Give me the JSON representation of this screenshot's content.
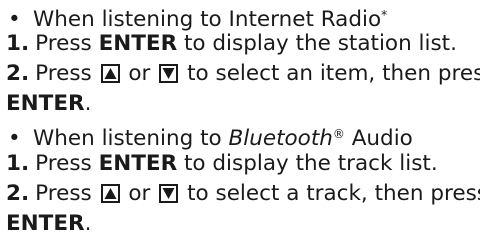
{
  "sections": [
    {
      "bullet": "•",
      "heading_prefix": "When listening to Internet Radio",
      "heading_mark": "*",
      "steps": [
        {
          "num": "1.",
          "pre": "Press ",
          "bold": "ENTER",
          "post": " to display the station list."
        },
        {
          "num": "2.",
          "pre": "Press ",
          "mid": " or ",
          "post": " to select an item, then press",
          "cont_bold": "ENTER",
          "cont_post": "."
        }
      ]
    },
    {
      "bullet": "•",
      "heading_prefix": "When listening to ",
      "heading_italic": "Bluetooth",
      "heading_reg": "®",
      "heading_suffix": " Audio",
      "steps": [
        {
          "num": "1.",
          "pre": "Press ",
          "bold": "ENTER",
          "post": " to display the track list."
        },
        {
          "num": "2.",
          "pre": "Press ",
          "mid": " or ",
          "post": " to select a track, then press",
          "cont_bold": "ENTER",
          "cont_post": "."
        }
      ]
    }
  ],
  "icons": {
    "up": "up-arrow-key-icon",
    "down": "down-arrow-key-icon"
  }
}
